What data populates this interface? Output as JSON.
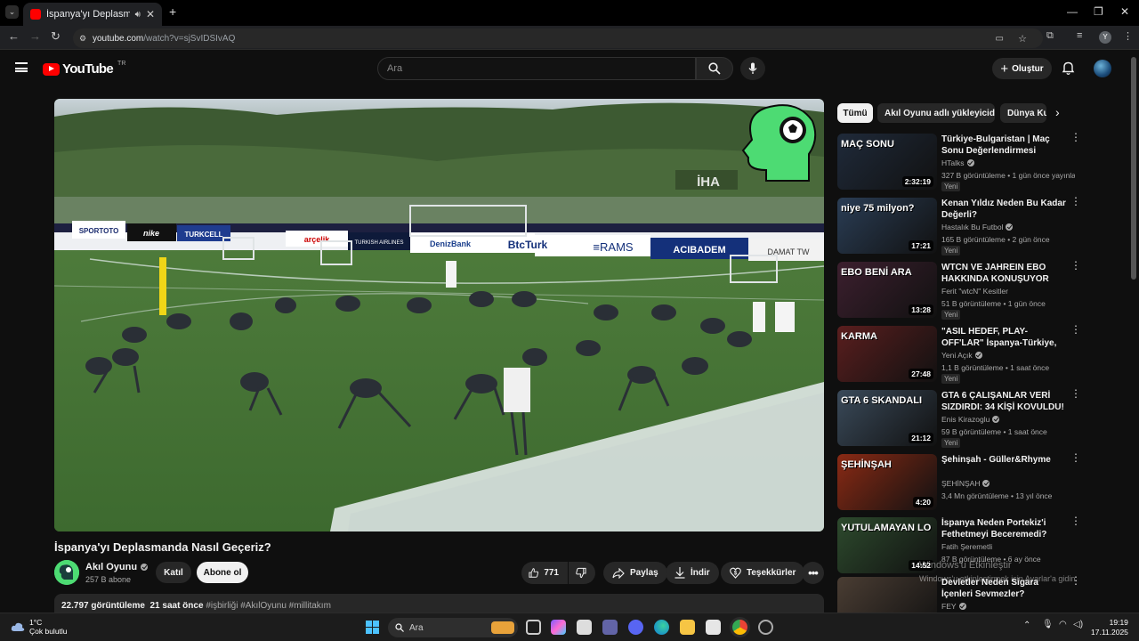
{
  "browser": {
    "tab_title": "İspanya'yı Deplasmanda Nas",
    "url_host": "youtube.com",
    "url_path": "/watch?v=sjSvIDSIvAQ"
  },
  "header": {
    "logo_text": "YouTube",
    "country_code": "TR",
    "search_placeholder": "Ara",
    "create_label": "Oluştur"
  },
  "player": {
    "ad_board_texts": [
      "SPORTOTO",
      "nike",
      "TURKCELL",
      "arçelik",
      "TURKISH AIRLINES",
      "DenizBank",
      "BtcTurk",
      "RAMS",
      "ACIBADEM",
      "DAMAT TWEEN"
    ],
    "press_badge": "İHA"
  },
  "video": {
    "title": "İspanya'yı Deplasmanda Nasıl Geçeriz?",
    "channel_name": "Akıl Oyunu",
    "subscribers": "257 B abone",
    "join_label": "Katıl",
    "subscribe_label": "Abone ol",
    "like_count": "771",
    "share_label": "Paylaş",
    "download_label": "İndir",
    "thanks_label": "Teşekkürler",
    "views": "22.797 görüntüleme",
    "uploaded": "21 saat önce",
    "hashtags": "#işbirliği #AkılOyunu #millitakım"
  },
  "chips": [
    "Tümü",
    "Akıl Oyunu adlı yükleyiciden",
    "Dünya Ku"
  ],
  "recommendations": [
    {
      "title": "Türkiye-Bulgaristan | Maç Sonu Değerlendirmesi",
      "channel": "HTalks",
      "verified": true,
      "meta": "327 B görüntüleme • 1 gün önce yayınlan...",
      "badge": "Yeni",
      "duration": "2:32:19",
      "thumb_text": "MAÇ SONU",
      "thumb_color": "#1f2a3a"
    },
    {
      "title": "Kenan Yıldız Neden Bu Kadar Değerli?",
      "channel": "Hastalık Bu Futbol",
      "verified": true,
      "meta": "165 B görüntüleme • 2 gün önce",
      "badge": "Yeni",
      "duration": "17:21",
      "thumb_text": "niye 75 milyon?",
      "thumb_color": "#2a3d55"
    },
    {
      "title": "WTCN VE JAHREIN EBO HAKKINDA KONUŞUYOR",
      "channel": "Ferit \"wtcN\" Kesitler",
      "verified": false,
      "meta": "51 B görüntüleme • 1 gün önce",
      "badge": "Yeni",
      "duration": "13:28",
      "thumb_text": "EBO BENİ ARA",
      "thumb_color": "#3c1f2e"
    },
    {
      "title": "\"ASIL HEDEF, PLAY-OFF'LAR\" İspanya-Türkiye, Erling Haalan...",
      "channel": "Yeni Açık",
      "verified": true,
      "meta": "1,1 B görüntüleme • 1 saat önce",
      "badge": "Yeni",
      "duration": "27:48",
      "thumb_text": "KARMA",
      "thumb_color": "#5a1e1e"
    },
    {
      "title": "GTA 6 ÇALIŞANLAR VERİ SIZDIRDI: 34 KİŞİ KOVULDU! ...",
      "channel": "Enis Kirazoglu",
      "verified": true,
      "meta": "59 B görüntüleme • 1 saat önce",
      "badge": "Yeni",
      "duration": "21:12",
      "thumb_text": "GTA 6 SKANDALI",
      "thumb_color": "#3a4a5a"
    },
    {
      "title": "Şehinşah - Güller&Rhyme",
      "channel": "ŞEHİNŞAH",
      "verified": true,
      "meta": "3,4 Mn görüntüleme • 13 yıl önce",
      "badge": "",
      "duration": "4:20",
      "thumb_text": "ŞEHİNŞAH",
      "thumb_color": "#8a2a14"
    },
    {
      "title": "İspanya Neden Portekiz'i Fethetmeyi Beceremedi?",
      "channel": "Fatih Şeremetli",
      "verified": false,
      "meta": "87 B görüntüleme • 6 ay önce",
      "badge": "",
      "duration": "14:52",
      "thumb_text": "YUTULAMAYAN LO",
      "thumb_color": "#2d4a2d"
    },
    {
      "title": "Devletler Neden Sigara İçenleri Sevmezler?",
      "channel": "FEY",
      "verified": true,
      "meta": "",
      "badge": "",
      "duration": "",
      "thumb_text": "",
      "thumb_color": "#4a3d33"
    }
  ],
  "watermark": {
    "line1": "Windows'u Etkinleştir",
    "line2": "Windows'u etkinleştirmek için Ayarlar'a gidin."
  },
  "taskbar": {
    "weather_temp": "1°C",
    "weather_desc": "Çok bulutlu",
    "search_label": "Ara",
    "time": "19:19",
    "date": "17.11.2025"
  }
}
